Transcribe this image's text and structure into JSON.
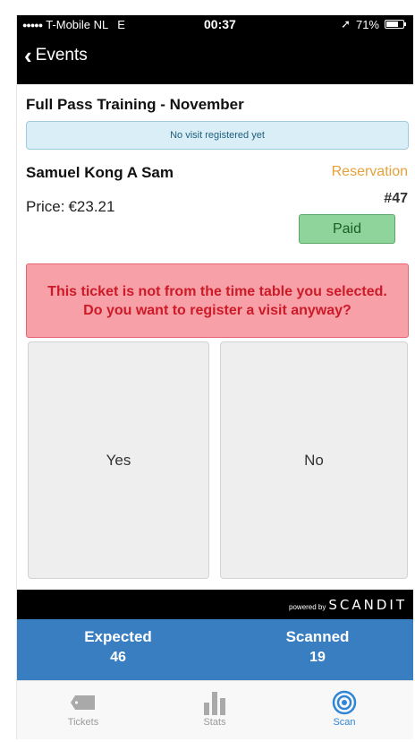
{
  "status_bar": {
    "carrier": "T-Mobile NL",
    "network": "E",
    "time": "00:37",
    "battery": "71%",
    "battery_level": 0.71
  },
  "nav": {
    "back_label": "Events"
  },
  "event": {
    "title": "Full Pass Training - November",
    "visit_status": "No visit registered yet"
  },
  "ticket": {
    "holder_name": "Samuel Kong A Sam",
    "type": "Reservation",
    "price_label": "Price:",
    "price": "€23.21",
    "number": "#47",
    "payment_status": "Paid"
  },
  "warning": {
    "message": "This ticket is not from the time table you selected. Do you want to register a visit anyway?"
  },
  "actions": {
    "yes_label": "Yes",
    "no_label": "No"
  },
  "powered_by": {
    "prefix": "powered by",
    "brand": "SCANDIT"
  },
  "counts": {
    "expected_label": "Expected",
    "expected_value": "46",
    "scanned_label": "Scanned",
    "scanned_value": "19"
  },
  "tabs": [
    {
      "label": "Tickets",
      "icon": "ticket-icon",
      "active": false
    },
    {
      "label": "Stats",
      "icon": "bar-chart-icon",
      "active": false
    },
    {
      "label": "Scan",
      "icon": "scan-target-icon",
      "active": true
    }
  ],
  "colors": {
    "accent_blue": "#3a7ec2",
    "tab_active": "#2f86d6",
    "reservation_orange": "#e6a13b",
    "warning_red": "#cc1a28",
    "paid_green": "#8fd49a"
  }
}
